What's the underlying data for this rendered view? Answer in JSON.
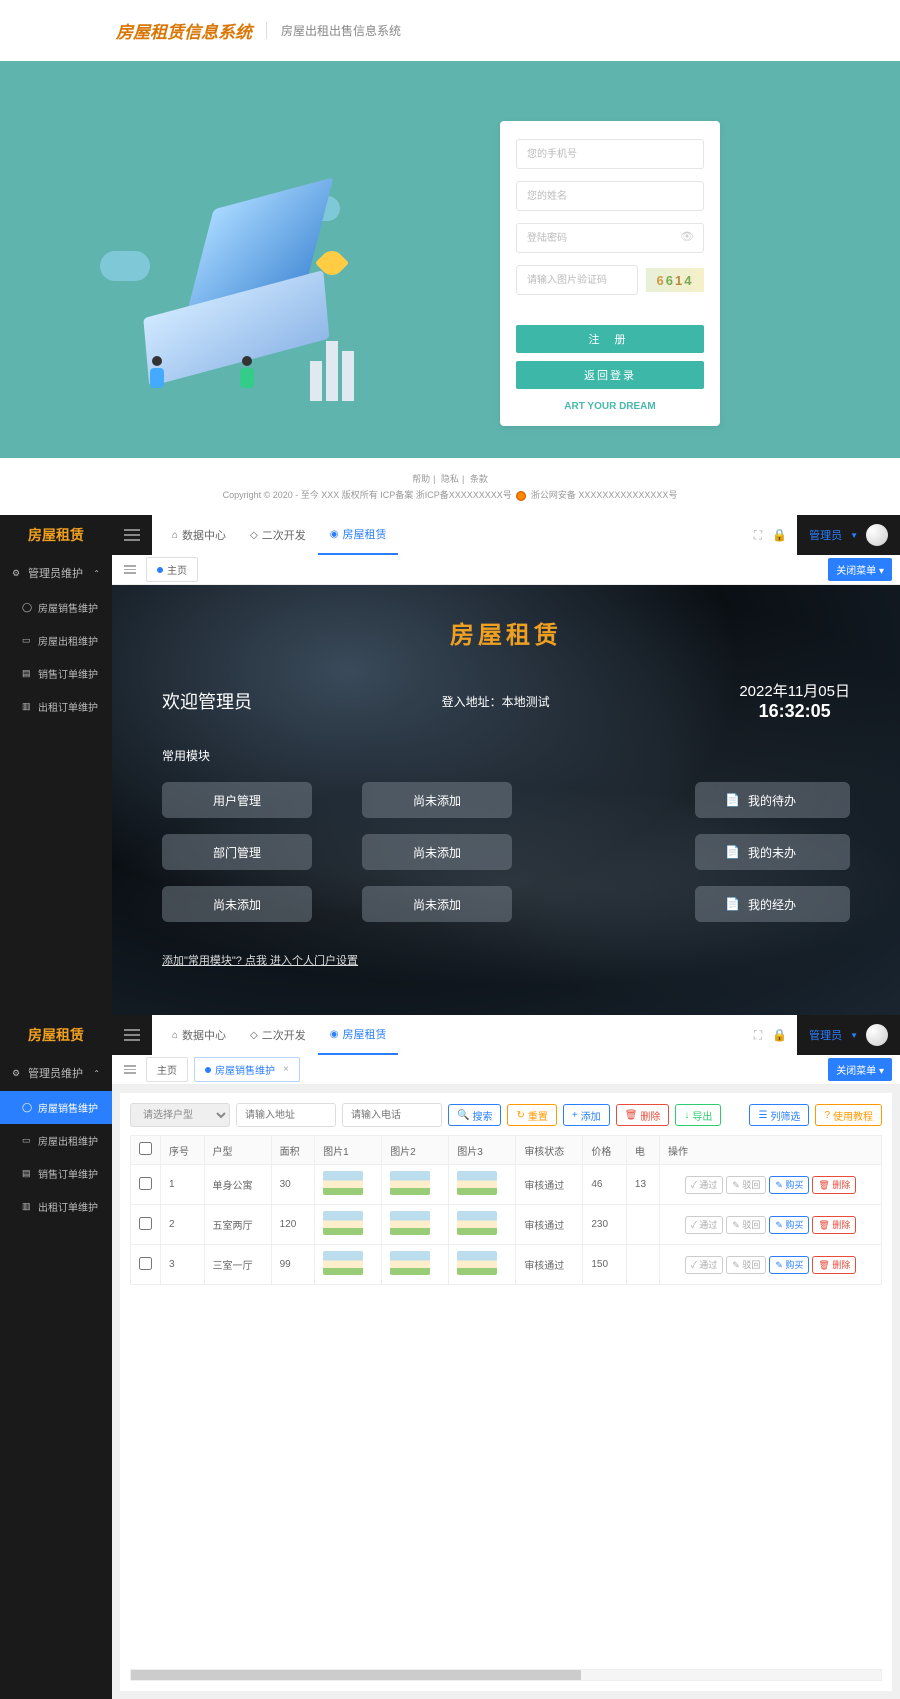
{
  "s1": {
    "logo": "房屋租赁信息系统",
    "sub": "房屋出租出售信息系统",
    "ph_phone": "您的手机号",
    "ph_name": "您的姓名",
    "ph_pwd": "登陆密码",
    "ph_cap": "请输入图片验证码",
    "captcha": [
      "6",
      "6",
      "1",
      "4"
    ],
    "btn_reg": "注 册",
    "btn_back": "返回登录",
    "tag": "ART YOUR DREAM",
    "ftr_links": [
      "帮助",
      "隐私",
      "条款"
    ],
    "copyright": "Copyright © 2020 - 至今 XXX 版权所有 ICP备案 浙ICP备XXXXXXXXX号",
    "beian": "浙公网安备 XXXXXXXXXXXXXXX号"
  },
  "admin": {
    "brand": "房屋租赁",
    "tabs": [
      {
        "icon": "⌂",
        "label": "数据中心"
      },
      {
        "icon": "◇",
        "label": "二次开发"
      },
      {
        "icon": "◉",
        "label": "房屋租赁",
        "on": true
      }
    ],
    "user": "管理员",
    "close_menu": "关闭菜单 ▾",
    "side_group": "管理员维护",
    "side": [
      {
        "icon": "◯",
        "label": "房屋销售维护"
      },
      {
        "icon": "▭",
        "label": "房屋出租维护"
      },
      {
        "icon": "▤",
        "label": "销售订单维护"
      },
      {
        "icon": "▥",
        "label": "出租订单维护"
      }
    ]
  },
  "s2": {
    "crumb": "主页",
    "title": "房屋租赁",
    "welcome": "欢迎管理员",
    "addr_lbl": "登入地址：",
    "addr": "本地测试",
    "date": "2022年11月05日",
    "time": "16:32:05",
    "common": "常用模块",
    "mods_l": [
      "用户管理",
      "部门管理",
      "尚未添加"
    ],
    "mods_m": [
      "尚未添加",
      "尚未添加",
      "尚未添加"
    ],
    "mods_r": [
      "我的待办",
      "我的未办",
      "我的经办"
    ],
    "link": "添加\"常用模块\"? 点我 进入个人门户设置"
  },
  "s3": {
    "crumb_home": "主页",
    "crumb_cur": "房屋销售维护",
    "sel_ph": "请选择户型",
    "inp1": "请输入地址",
    "inp2": "请输入电话",
    "btn_search": "搜索",
    "btn_reset": "重置",
    "btn_add": "添加",
    "btn_del": "删除",
    "btn_exp": "导出",
    "btn_cols": "列筛选",
    "btn_help": "使用教程",
    "cols": [
      "",
      "序号",
      "户型",
      "面积",
      "图片1",
      "图片2",
      "图片3",
      "审核状态",
      "价格",
      "电",
      "操作"
    ],
    "rows": [
      {
        "no": "1",
        "type": "单身公寓",
        "area": "30",
        "status": "审核通过",
        "price": "46",
        "e": "13"
      },
      {
        "no": "2",
        "type": "五室两厅",
        "area": "120",
        "status": "审核通过",
        "price": "230",
        "e": ""
      },
      {
        "no": "3",
        "type": "三室一厅",
        "area": "99",
        "status": "审核通过",
        "price": "150",
        "e": ""
      }
    ],
    "op_pass": "通过",
    "op_rej": "驳回",
    "op_buy": "购买",
    "op_del": "删除"
  }
}
